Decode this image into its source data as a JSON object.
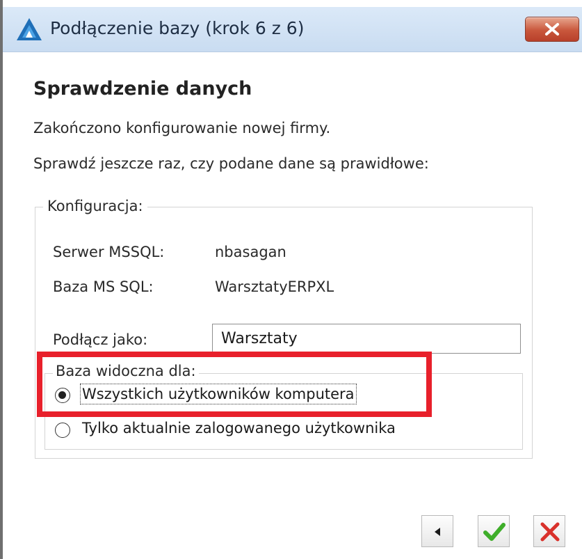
{
  "window": {
    "title": "Podłączenie bazy (krok 6 z 6)"
  },
  "content": {
    "heading": "Sprawdzenie danych",
    "line1": "Zakończono konfigurowanie nowej firmy.",
    "line2": "Sprawdź jeszcze raz, czy podane dane są prawidłowe:"
  },
  "config": {
    "group_label": "Konfiguracja:",
    "server_label": "Serwer MSSQL:",
    "server_value": "nbasagan",
    "database_label": "Baza MS SQL:",
    "database_value": "WarsztatyERPXL",
    "connect_as_label": "Podłącz jako:",
    "connect_as_value": "Warsztaty"
  },
  "visibility": {
    "group_label": "Baza widoczna dla:",
    "options": [
      {
        "label": "Wszystkich użytkowników komputera",
        "checked": true
      },
      {
        "label": "Tylko aktualnie zalogowanego użytkownika",
        "checked": false
      }
    ]
  },
  "icons": {
    "app": "blue-triangle-logo-icon",
    "close": "close-icon",
    "back": "back-arrow-icon",
    "confirm": "checkmark-icon",
    "cancel": "red-x-icon"
  },
  "colors": {
    "highlight": "#e8202b",
    "confirm": "#3fae2a",
    "cancel": "#d9312b"
  }
}
